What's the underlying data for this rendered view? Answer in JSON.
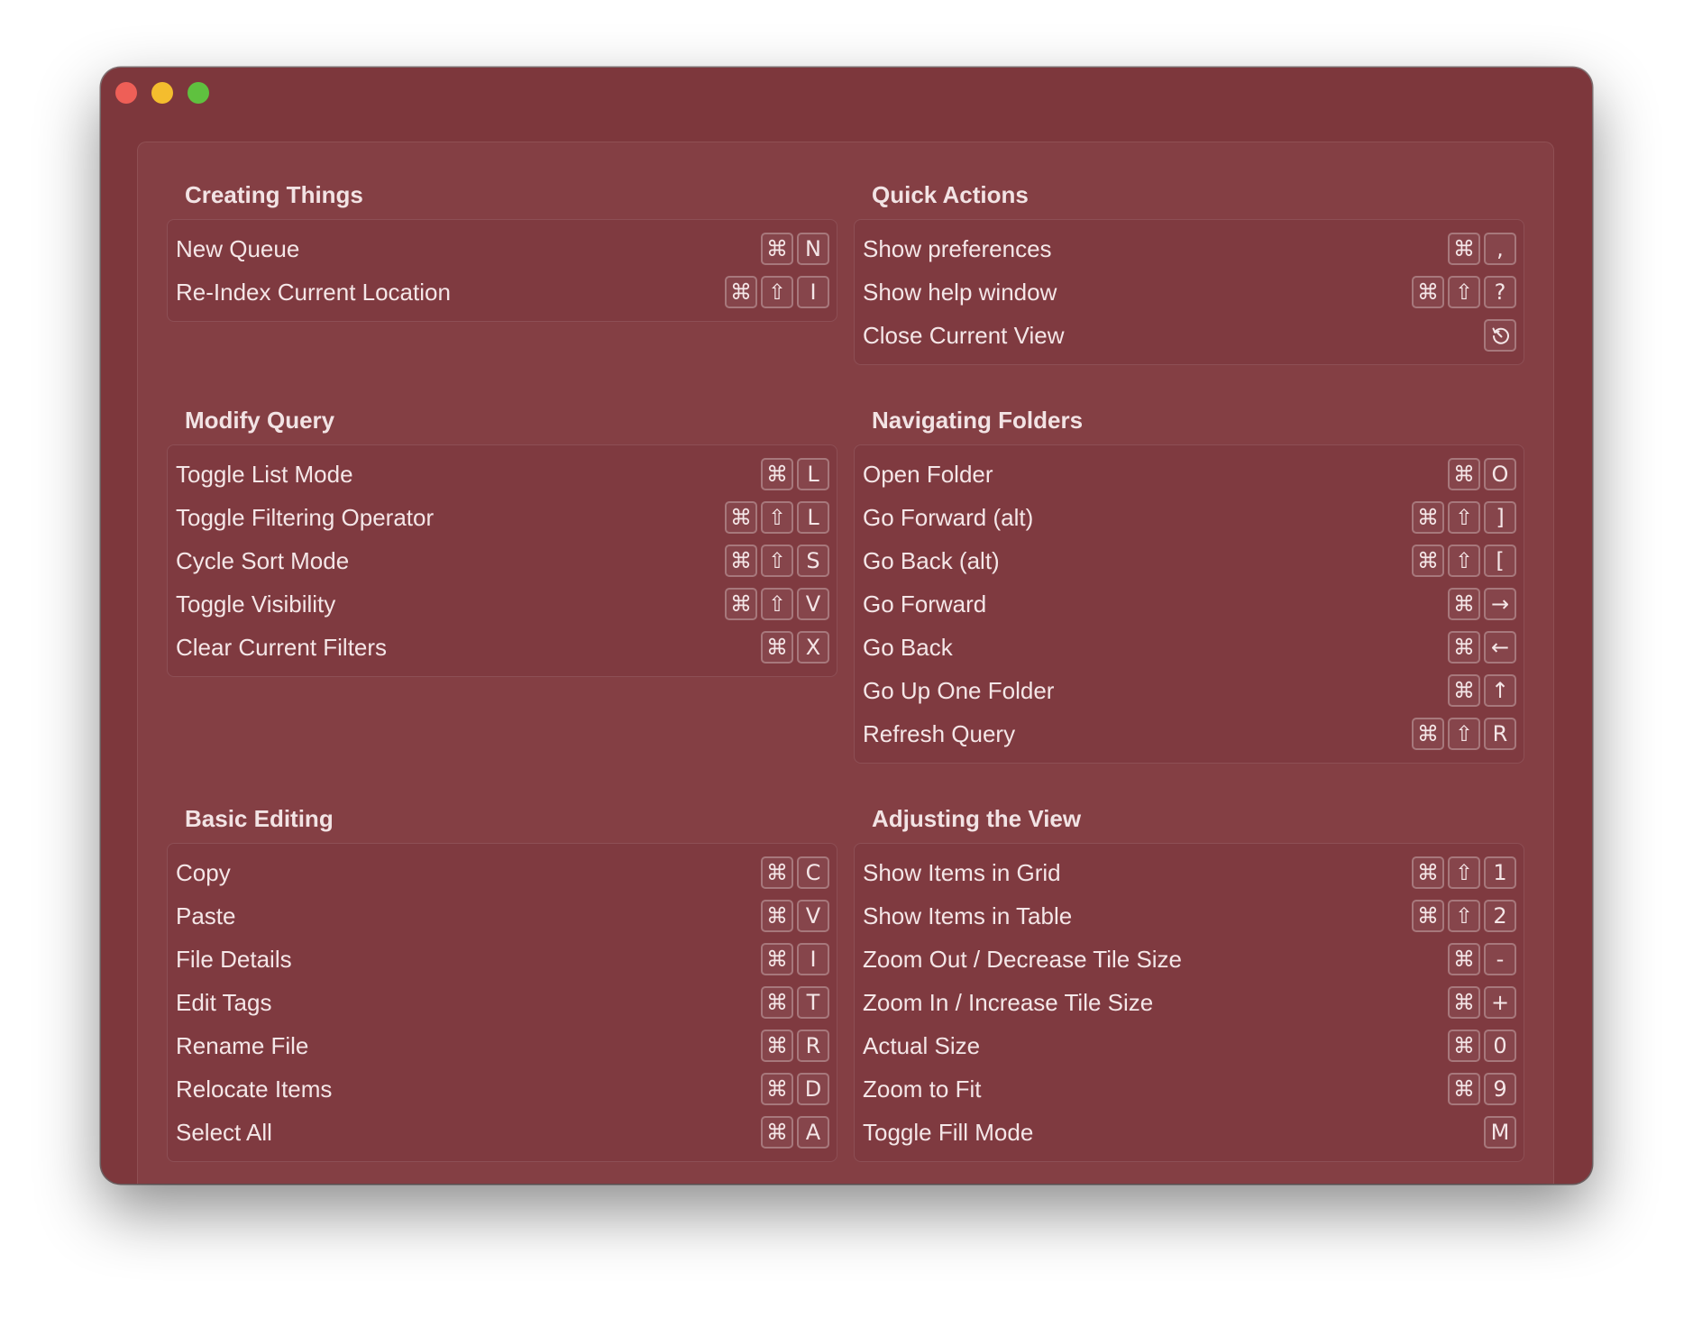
{
  "window": {
    "traffic_lights": [
      "close",
      "minimize",
      "zoom"
    ]
  },
  "sections": {
    "creating_things": {
      "title": "Creating Things",
      "items": [
        {
          "label": "New Queue",
          "keys": [
            "⌘",
            "N"
          ]
        },
        {
          "label": "Re-Index Current Location",
          "keys": [
            "⌘",
            "⇧",
            "I"
          ]
        }
      ]
    },
    "quick_actions": {
      "title": "Quick Actions",
      "items": [
        {
          "label": "Show preferences",
          "keys": [
            "⌘",
            ","
          ]
        },
        {
          "label": "Show help window",
          "keys": [
            "⌘",
            "⇧",
            "?"
          ]
        },
        {
          "label": "Close Current View",
          "keys": [
            "escape-icon"
          ]
        }
      ]
    },
    "modify_query": {
      "title": "Modify Query",
      "items": [
        {
          "label": "Toggle List Mode",
          "keys": [
            "⌘",
            "L"
          ]
        },
        {
          "label": "Toggle Filtering Operator",
          "keys": [
            "⌘",
            "⇧",
            "L"
          ]
        },
        {
          "label": "Cycle Sort Mode",
          "keys": [
            "⌘",
            "⇧",
            "S"
          ]
        },
        {
          "label": "Toggle Visibility",
          "keys": [
            "⌘",
            "⇧",
            "V"
          ]
        },
        {
          "label": "Clear Current Filters",
          "keys": [
            "⌘",
            "X"
          ]
        }
      ]
    },
    "navigating_folders": {
      "title": "Navigating Folders",
      "items": [
        {
          "label": "Open Folder",
          "keys": [
            "⌘",
            "O"
          ]
        },
        {
          "label": "Go Forward (alt)",
          "keys": [
            "⌘",
            "⇧",
            "]"
          ]
        },
        {
          "label": "Go Back (alt)",
          "keys": [
            "⌘",
            "⇧",
            "["
          ]
        },
        {
          "label": "Go Forward",
          "keys": [
            "⌘",
            "→"
          ]
        },
        {
          "label": "Go Back",
          "keys": [
            "⌘",
            "←"
          ]
        },
        {
          "label": "Go Up One Folder",
          "keys": [
            "⌘",
            "↑"
          ]
        },
        {
          "label": "Refresh Query",
          "keys": [
            "⌘",
            "⇧",
            "R"
          ]
        }
      ]
    },
    "basic_editing": {
      "title": "Basic Editing",
      "items": [
        {
          "label": "Copy",
          "keys": [
            "⌘",
            "C"
          ]
        },
        {
          "label": "Paste",
          "keys": [
            "⌘",
            "V"
          ]
        },
        {
          "label": "File Details",
          "keys": [
            "⌘",
            "I"
          ]
        },
        {
          "label": "Edit Tags",
          "keys": [
            "⌘",
            "T"
          ]
        },
        {
          "label": "Rename File",
          "keys": [
            "⌘",
            "R"
          ]
        },
        {
          "label": "Relocate Items",
          "keys": [
            "⌘",
            "D"
          ]
        },
        {
          "label": "Select All",
          "keys": [
            "⌘",
            "A"
          ]
        }
      ]
    },
    "adjusting_the_view": {
      "title": "Adjusting the View",
      "items": [
        {
          "label": "Show Items in Grid",
          "keys": [
            "⌘",
            "⇧",
            "1"
          ]
        },
        {
          "label": "Show Items in Table",
          "keys": [
            "⌘",
            "⇧",
            "2"
          ]
        },
        {
          "label": "Zoom Out / Decrease Tile Size",
          "keys": [
            "⌘",
            "-"
          ]
        },
        {
          "label": "Zoom In / Increase Tile Size",
          "keys": [
            "⌘",
            "+"
          ]
        },
        {
          "label": "Actual Size",
          "keys": [
            "⌘",
            "0"
          ]
        },
        {
          "label": "Zoom to Fit",
          "keys": [
            "⌘",
            "9"
          ]
        },
        {
          "label": "Toggle Fill Mode",
          "keys": [
            "M"
          ]
        }
      ]
    }
  }
}
